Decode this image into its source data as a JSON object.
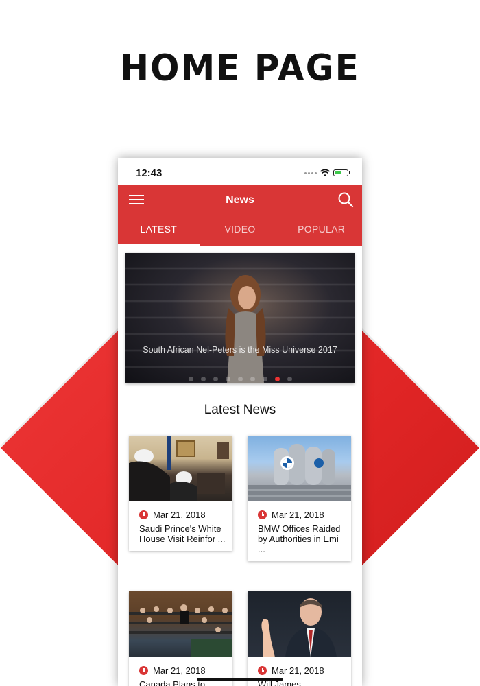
{
  "promo": {
    "title": "HOME PAGE"
  },
  "status": {
    "time": "12:43"
  },
  "appbar": {
    "title": "News"
  },
  "tabs": [
    {
      "label": "LATEST",
      "active": true
    },
    {
      "label": "VIDEO",
      "active": false
    },
    {
      "label": "POPULAR",
      "active": false
    }
  ],
  "hero": {
    "caption": "South African Nel-Peters is the Miss Universe 2017",
    "slide_count": 9,
    "active_slide": 8
  },
  "section": {
    "title": "Latest News"
  },
  "cards": [
    {
      "date": "Mar 21, 2018",
      "headline": "Saudi Prince's White House Visit Reinfor ..."
    },
    {
      "date": "Mar 21, 2018",
      "headline": "BMW Offices Raided by Authorities in Emi ..."
    },
    {
      "date": "Mar 21, 2018",
      "headline": "Canada Plans to"
    },
    {
      "date": "Mar 21, 2018",
      "headline": "Will James"
    }
  ],
  "colors": {
    "brand_red": "#d93636",
    "accent_red": "#e02525"
  }
}
